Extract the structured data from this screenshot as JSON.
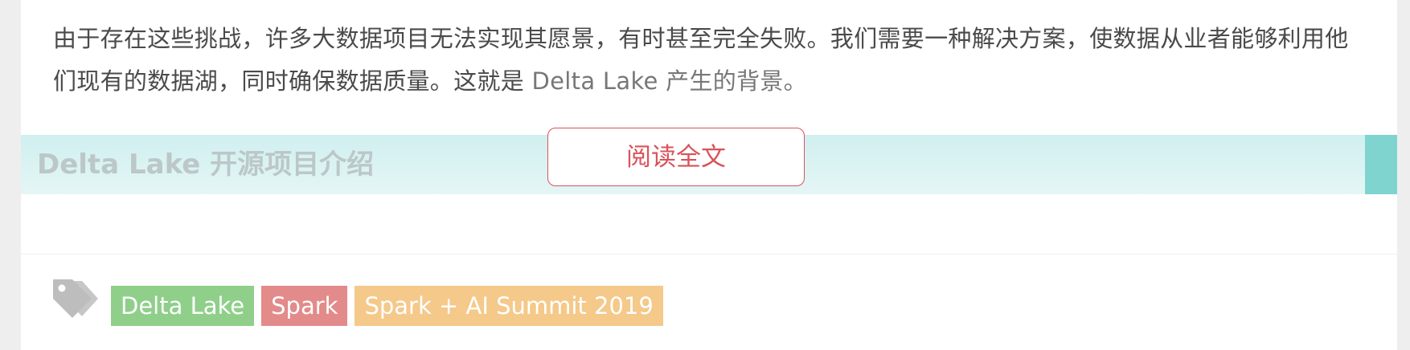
{
  "article": {
    "paragraph_main": "由于存在这些挑战，许多大数据项目无法实现其愿景，有时甚至完全失败。我们需要一种解决方案，使数据从业者能够利用他们现有的数据湖，同时确保数据质量。这就是 ",
    "paragraph_tail": "Delta Lake 产生的背景。"
  },
  "section": {
    "title": "Delta Lake 开源项目介绍"
  },
  "read_more": {
    "label": "阅读全文"
  },
  "tags": [
    {
      "label": "Delta Lake",
      "color": "#8fcf8a"
    },
    {
      "label": "Spark",
      "color": "#e38a8a"
    },
    {
      "label": "Spark + AI Summit 2019",
      "color": "#f4c98a"
    }
  ],
  "colors": {
    "accent": "#7fd4cf",
    "button": "#d9535a",
    "tag_icon": "#bdbdbd"
  }
}
